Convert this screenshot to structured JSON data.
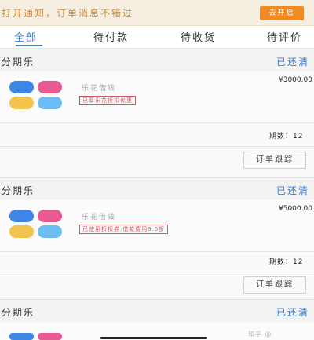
{
  "notice": {
    "text": "打开通知，订单消息不错过",
    "button_label": "去开启"
  },
  "tabs": [
    {
      "label": "全部",
      "active": true
    },
    {
      "label": "待付款",
      "active": false
    },
    {
      "label": "待收货",
      "active": false
    },
    {
      "label": "待评价",
      "active": false
    }
  ],
  "orders": [
    {
      "merchant": "分期乐",
      "status": "已还清",
      "product": "乐花借钱",
      "tag": "已享乐花折扣优惠",
      "price": "¥3000.00",
      "period_label": "期数：12",
      "track_label": "订单跟踪"
    },
    {
      "merchant": "分期乐",
      "status": "已还清",
      "product": "乐花借钱",
      "tag": "已使用折扣券,借款费用9.5折",
      "price": "¥5000.00",
      "period_label": "期数：12",
      "track_label": "订单跟踪"
    },
    {
      "merchant": "分期乐",
      "status": "已还清"
    }
  ],
  "watermark": "知乎 @",
  "colors": {
    "accent_blue": "#3b7fd6",
    "notice_orange": "#f08a25",
    "tag_red": "#c65b64"
  }
}
